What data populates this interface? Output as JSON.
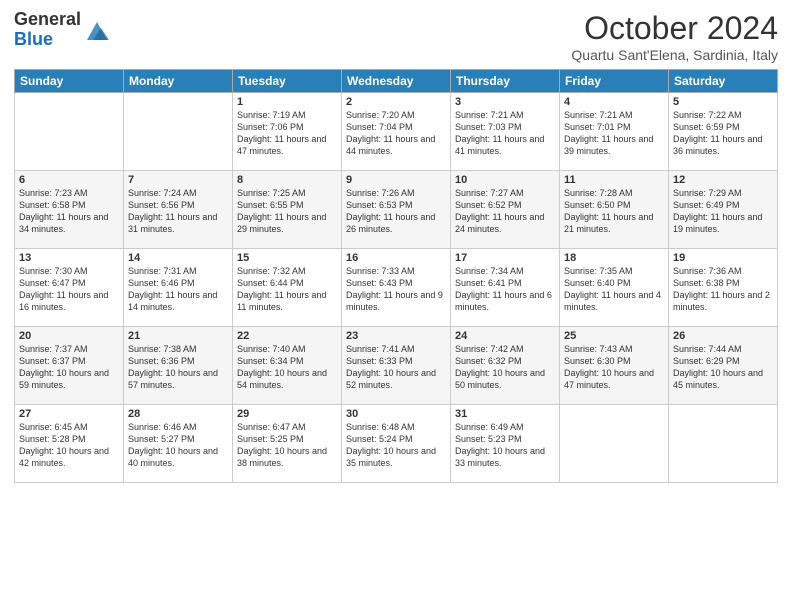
{
  "logo": {
    "general": "General",
    "blue": "Blue"
  },
  "header": {
    "title": "October 2024",
    "subtitle": "Quartu Sant'Elena, Sardinia, Italy"
  },
  "days_of_week": [
    "Sunday",
    "Monday",
    "Tuesday",
    "Wednesday",
    "Thursday",
    "Friday",
    "Saturday"
  ],
  "weeks": [
    [
      {
        "day": "",
        "info": ""
      },
      {
        "day": "",
        "info": ""
      },
      {
        "day": "1",
        "info": "Sunrise: 7:19 AM\nSunset: 7:06 PM\nDaylight: 11 hours and 47 minutes."
      },
      {
        "day": "2",
        "info": "Sunrise: 7:20 AM\nSunset: 7:04 PM\nDaylight: 11 hours and 44 minutes."
      },
      {
        "day": "3",
        "info": "Sunrise: 7:21 AM\nSunset: 7:03 PM\nDaylight: 11 hours and 41 minutes."
      },
      {
        "day": "4",
        "info": "Sunrise: 7:21 AM\nSunset: 7:01 PM\nDaylight: 11 hours and 39 minutes."
      },
      {
        "day": "5",
        "info": "Sunrise: 7:22 AM\nSunset: 6:59 PM\nDaylight: 11 hours and 36 minutes."
      }
    ],
    [
      {
        "day": "6",
        "info": "Sunrise: 7:23 AM\nSunset: 6:58 PM\nDaylight: 11 hours and 34 minutes."
      },
      {
        "day": "7",
        "info": "Sunrise: 7:24 AM\nSunset: 6:56 PM\nDaylight: 11 hours and 31 minutes."
      },
      {
        "day": "8",
        "info": "Sunrise: 7:25 AM\nSunset: 6:55 PM\nDaylight: 11 hours and 29 minutes."
      },
      {
        "day": "9",
        "info": "Sunrise: 7:26 AM\nSunset: 6:53 PM\nDaylight: 11 hours and 26 minutes."
      },
      {
        "day": "10",
        "info": "Sunrise: 7:27 AM\nSunset: 6:52 PM\nDaylight: 11 hours and 24 minutes."
      },
      {
        "day": "11",
        "info": "Sunrise: 7:28 AM\nSunset: 6:50 PM\nDaylight: 11 hours and 21 minutes."
      },
      {
        "day": "12",
        "info": "Sunrise: 7:29 AM\nSunset: 6:49 PM\nDaylight: 11 hours and 19 minutes."
      }
    ],
    [
      {
        "day": "13",
        "info": "Sunrise: 7:30 AM\nSunset: 6:47 PM\nDaylight: 11 hours and 16 minutes."
      },
      {
        "day": "14",
        "info": "Sunrise: 7:31 AM\nSunset: 6:46 PM\nDaylight: 11 hours and 14 minutes."
      },
      {
        "day": "15",
        "info": "Sunrise: 7:32 AM\nSunset: 6:44 PM\nDaylight: 11 hours and 11 minutes."
      },
      {
        "day": "16",
        "info": "Sunrise: 7:33 AM\nSunset: 6:43 PM\nDaylight: 11 hours and 9 minutes."
      },
      {
        "day": "17",
        "info": "Sunrise: 7:34 AM\nSunset: 6:41 PM\nDaylight: 11 hours and 6 minutes."
      },
      {
        "day": "18",
        "info": "Sunrise: 7:35 AM\nSunset: 6:40 PM\nDaylight: 11 hours and 4 minutes."
      },
      {
        "day": "19",
        "info": "Sunrise: 7:36 AM\nSunset: 6:38 PM\nDaylight: 11 hours and 2 minutes."
      }
    ],
    [
      {
        "day": "20",
        "info": "Sunrise: 7:37 AM\nSunset: 6:37 PM\nDaylight: 10 hours and 59 minutes."
      },
      {
        "day": "21",
        "info": "Sunrise: 7:38 AM\nSunset: 6:36 PM\nDaylight: 10 hours and 57 minutes."
      },
      {
        "day": "22",
        "info": "Sunrise: 7:40 AM\nSunset: 6:34 PM\nDaylight: 10 hours and 54 minutes."
      },
      {
        "day": "23",
        "info": "Sunrise: 7:41 AM\nSunset: 6:33 PM\nDaylight: 10 hours and 52 minutes."
      },
      {
        "day": "24",
        "info": "Sunrise: 7:42 AM\nSunset: 6:32 PM\nDaylight: 10 hours and 50 minutes."
      },
      {
        "day": "25",
        "info": "Sunrise: 7:43 AM\nSunset: 6:30 PM\nDaylight: 10 hours and 47 minutes."
      },
      {
        "day": "26",
        "info": "Sunrise: 7:44 AM\nSunset: 6:29 PM\nDaylight: 10 hours and 45 minutes."
      }
    ],
    [
      {
        "day": "27",
        "info": "Sunrise: 6:45 AM\nSunset: 5:28 PM\nDaylight: 10 hours and 42 minutes."
      },
      {
        "day": "28",
        "info": "Sunrise: 6:46 AM\nSunset: 5:27 PM\nDaylight: 10 hours and 40 minutes."
      },
      {
        "day": "29",
        "info": "Sunrise: 6:47 AM\nSunset: 5:25 PM\nDaylight: 10 hours and 38 minutes."
      },
      {
        "day": "30",
        "info": "Sunrise: 6:48 AM\nSunset: 5:24 PM\nDaylight: 10 hours and 35 minutes."
      },
      {
        "day": "31",
        "info": "Sunrise: 6:49 AM\nSunset: 5:23 PM\nDaylight: 10 hours and 33 minutes."
      },
      {
        "day": "",
        "info": ""
      },
      {
        "day": "",
        "info": ""
      }
    ]
  ]
}
